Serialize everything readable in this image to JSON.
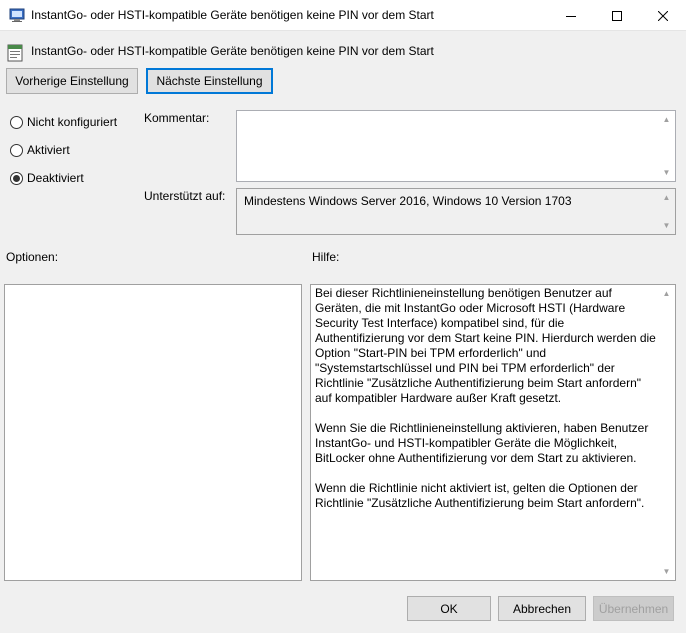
{
  "window": {
    "title": "InstantGo- oder HSTI-kompatible Geräte benötigen keine PIN vor dem Start"
  },
  "header": {
    "setting_name": "InstantGo- oder HSTI-kompatible Geräte benötigen keine PIN vor dem Start"
  },
  "nav": {
    "previous_label": "Vorherige Einstellung",
    "next_label": "Nächste Einstellung"
  },
  "state": {
    "options": [
      {
        "label": "Nicht konfiguriert",
        "checked": false
      },
      {
        "label": "Aktiviert",
        "checked": false
      },
      {
        "label": "Deaktiviert",
        "checked": true
      }
    ]
  },
  "comment": {
    "label": "Kommentar:",
    "value": ""
  },
  "supported": {
    "label": "Unterstützt auf:",
    "value": "Mindestens Windows Server 2016, Windows 10 Version 1703"
  },
  "options_panel": {
    "label": "Optionen:"
  },
  "help_panel": {
    "label": "Hilfe:",
    "text": "Bei dieser Richtlinieneinstellung benötigen Benutzer auf Geräten, die mit InstantGo oder Microsoft HSTI (Hardware Security Test Interface) kompatibel sind, für die Authentifizierung vor dem Start keine PIN. Hierdurch werden die Option \"Start-PIN bei TPM erforderlich\" und \"Systemstartschlüssel und PIN bei TPM erforderlich\" der Richtlinie \"Zusätzliche Authentifizierung beim Start anfordern\" auf kompatibler Hardware außer Kraft gesetzt.\n\nWenn Sie die Richtlinieneinstellung aktivieren, haben Benutzer InstantGo- und HSTI-kompatibler Geräte die Möglichkeit, BitLocker ohne Authentifizierung vor dem Start zu aktivieren.\n\nWenn die Richtlinie nicht aktiviert ist, gelten die Optionen der Richtlinie \"Zusätzliche Authentifizierung beim Start anfordern\"."
  },
  "footer": {
    "ok_label": "OK",
    "cancel_label": "Abbrechen",
    "apply_label": "Übernehmen"
  },
  "colors": {
    "focus_border": "#0078d7",
    "button_bg": "#e1e1e1",
    "dialog_bg": "#f0f0f0"
  },
  "icons": {
    "title": "policy-setting-icon",
    "header": "policy-document-icon"
  }
}
